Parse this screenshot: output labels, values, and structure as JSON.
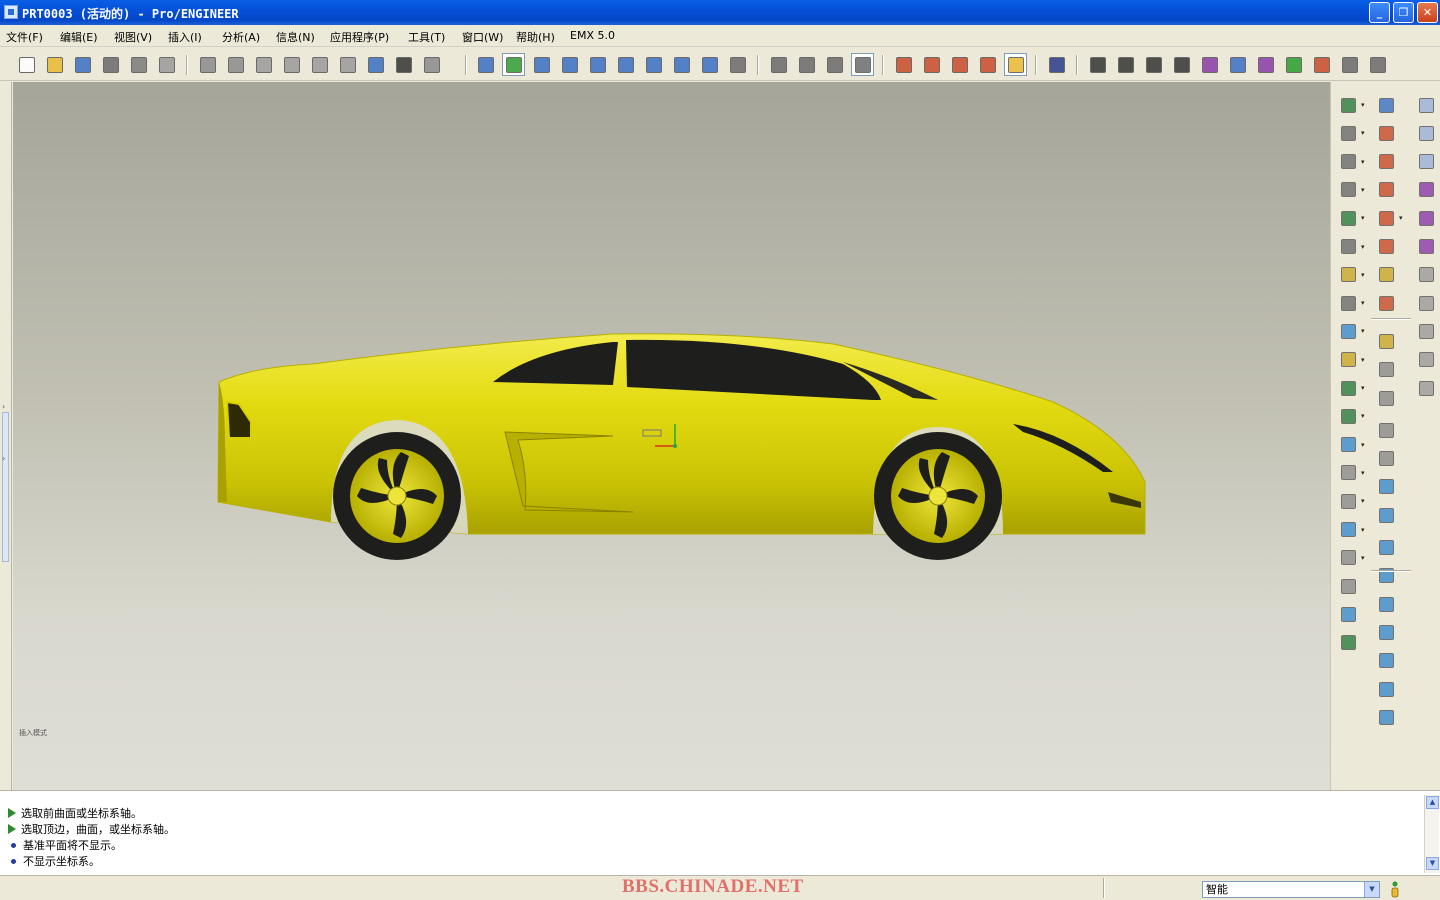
{
  "window": {
    "title": "PRT0003 (活动的) - Pro/ENGINEER",
    "minimize_label": "_",
    "restore_label": "❐",
    "close_label": "✕"
  },
  "menu": [
    {
      "label": "文件(F)"
    },
    {
      "label": "编辑(E)"
    },
    {
      "label": "视图(V)"
    },
    {
      "label": "插入(I)"
    },
    {
      "label": "分析(A)"
    },
    {
      "label": "信息(N)"
    },
    {
      "label": "应用程序(P)"
    },
    {
      "label": "工具(T)"
    },
    {
      "label": "窗口(W)"
    },
    {
      "label": "帮助(H)"
    },
    {
      "label": "EMX 5.0"
    }
  ],
  "toolbar": {
    "buttons": [
      {
        "icon": "new-file-icon",
        "color": "#FFFFFF"
      },
      {
        "icon": "open-folder-icon",
        "color": "#E8B830"
      },
      {
        "icon": "save-icon",
        "color": "#3A6FC4"
      },
      {
        "icon": "print-icon",
        "color": "#6A6A6A"
      },
      {
        "icon": "send-mail-icon",
        "color": "#7A7A7A"
      },
      {
        "icon": "print-preview-icon",
        "color": "#9A9A9A"
      },
      {
        "icon": "undo-icon",
        "color": "#8A8A8A"
      },
      {
        "icon": "redo-icon",
        "color": "#8A8A8A"
      },
      {
        "icon": "cut-icon",
        "color": "#9A9A9A"
      },
      {
        "icon": "copy-icon",
        "color": "#9A9A9A"
      },
      {
        "icon": "paste-icon",
        "color": "#9A9A9A"
      },
      {
        "icon": "paste-special-icon",
        "color": "#9A9A9A"
      },
      {
        "icon": "regenerate-icon",
        "color": "#3A6FC4"
      },
      {
        "icon": "find-icon",
        "color": "#333333"
      },
      {
        "icon": "selection-box-icon",
        "color": "#8A8A8A"
      },
      {
        "icon": "repaint-icon",
        "color": "#3A6FC4"
      },
      {
        "icon": "spin-center-icon",
        "color": "#2C9C2C"
      },
      {
        "icon": "orient-mode-icon",
        "color": "#3A6FC4"
      },
      {
        "icon": "zoom-in-icon",
        "color": "#3A6FC4"
      },
      {
        "icon": "zoom-out-icon",
        "color": "#3A6FC4"
      },
      {
        "icon": "refit-icon",
        "color": "#3A6FC4"
      },
      {
        "icon": "reorient-icon",
        "color": "#3A6FC4"
      },
      {
        "icon": "saved-views-icon",
        "color": "#3A6FC4"
      },
      {
        "icon": "layers-icon",
        "color": "#3A6FC4"
      },
      {
        "icon": "view-manager-icon",
        "color": "#6A6A6A"
      },
      {
        "icon": "wireframe-icon",
        "color": "#6A6A6A"
      },
      {
        "icon": "hidden-line-icon",
        "color": "#6A6A6A"
      },
      {
        "icon": "no-hidden-icon",
        "color": "#6A6A6A"
      },
      {
        "icon": "shading-icon",
        "color": "#6A6A6A"
      },
      {
        "icon": "datum-plane-toggle-icon",
        "color": "#C84A2A"
      },
      {
        "icon": "datum-axis-toggle-icon",
        "color": "#C84A2A"
      },
      {
        "icon": "datum-point-toggle-icon",
        "color": "#C84A2A"
      },
      {
        "icon": "coordinate-system-toggle-icon",
        "color": "#C84A2A"
      },
      {
        "icon": "annotation-toggle-icon",
        "color": "#E8B830"
      },
      {
        "icon": "context-help-icon",
        "color": "#2A3A8A"
      },
      {
        "icon": "measure-distance-icon",
        "color": "#333333"
      },
      {
        "icon": "measure-angle-icon",
        "color": "#333333"
      },
      {
        "icon": "measure-area-icon",
        "color": "#333333"
      },
      {
        "icon": "mass-properties-icon",
        "color": "#333333"
      },
      {
        "icon": "curvature-analysis-icon",
        "color": "#8A3AA8"
      },
      {
        "icon": "section-analysis-icon",
        "color": "#3A6FC4"
      },
      {
        "icon": "deviation-analysis-icon",
        "color": "#8A3AA8"
      },
      {
        "icon": "draft-analysis-icon",
        "color": "#2C9C2C"
      },
      {
        "icon": "reflection-analysis-icon",
        "color": "#C84A2A"
      },
      {
        "icon": "saved-analysis-icon",
        "color": "#6A6A6A"
      },
      {
        "icon": "hide-analysis-icon",
        "color": "#6A6A6A"
      }
    ]
  },
  "right_tools": {
    "col1": [
      {
        "icon": "hole-tool-icon",
        "color": "#2C7C3C"
      },
      {
        "icon": "shell-tool-icon",
        "color": "#6A6A6A"
      },
      {
        "icon": "rib-tool-icon",
        "color": "#6A6A6A"
      },
      {
        "icon": "draft-tool-icon",
        "color": "#6A6A6A"
      },
      {
        "icon": "round-tool-icon",
        "color": "#2C7C3C"
      },
      {
        "icon": "chamfer-tool-icon",
        "color": "#6A6A6A"
      },
      {
        "icon": "cosmetic-thread-icon",
        "color": "#C8A82A"
      },
      {
        "icon": "extrude-tool-icon",
        "color": "#6A6A6A"
      },
      {
        "icon": "revolve-tool-icon",
        "color": "#3A8ACA"
      },
      {
        "icon": "variable-section-sweep-icon",
        "color": "#C8A82A"
      },
      {
        "icon": "boundary-blend-icon",
        "color": "#2C7C3C"
      },
      {
        "icon": "style-tool-icon",
        "color": "#2C7C3C"
      },
      {
        "icon": "merge-tool-icon",
        "color": "#3A8ACA"
      },
      {
        "icon": "trim-tool-icon",
        "color": "#8A8A8A"
      },
      {
        "icon": "pattern-tool-icon",
        "color": "#8A8A8A"
      },
      {
        "icon": "mirror-tool-icon",
        "color": "#3A8ACA"
      },
      {
        "icon": "rebuild-tool-icon",
        "color": "#8A8A8A"
      },
      {
        "icon": "freeform-tool-icon",
        "color": "#8A8A8A"
      },
      {
        "icon": "warp-tool-icon",
        "color": "#3A8ACA"
      },
      {
        "icon": "emx-icon",
        "color": "#2C7C3C"
      }
    ],
    "col2": [
      {
        "icon": "sketch-tool-icon",
        "color": "#3A6FC4"
      },
      {
        "icon": "datum-plane-tool-icon",
        "color": "#C84A2A"
      },
      {
        "icon": "datum-axis-tool-icon",
        "color": "#C84A2A"
      },
      {
        "icon": "datum-curve-tool-icon",
        "color": "#C84A2A"
      },
      {
        "icon": "datum-point-tool-icon",
        "color": "#C84A2A"
      },
      {
        "icon": "coordinate-system-tool-icon",
        "color": "#C84A2A"
      },
      {
        "icon": "analysis-feature-icon",
        "color": "#C8A82A"
      },
      {
        "icon": "chain-tool-icon",
        "color": "#C84A2A"
      },
      {
        "icon": "placement-tool-icon",
        "color": "#C8A82A"
      },
      {
        "icon": "copy-paste-tool-icon",
        "color": "#8A8A8A"
      },
      {
        "icon": "shape-tool-icon",
        "color": "#8A8A8A"
      },
      {
        "icon": "offset-tool-icon",
        "color": "#8A8A8A"
      },
      {
        "icon": "thicken-tool-icon",
        "color": "#8A8A8A"
      },
      {
        "icon": "solidify-tool-icon",
        "color": "#3A8ACA"
      },
      {
        "icon": "extend-tool-icon",
        "color": "#3A8ACA"
      },
      {
        "icon": "intersect-tool-icon",
        "color": "#3A8ACA"
      },
      {
        "icon": "project-tool-icon",
        "color": "#3A8ACA"
      },
      {
        "icon": "wrap-tool-icon",
        "color": "#3A8ACA"
      },
      {
        "icon": "fill-tool-icon",
        "color": "#3A8ACA"
      },
      {
        "icon": "blend-surface-icon",
        "color": "#3A8ACA"
      },
      {
        "icon": "boundary-surface-icon",
        "color": "#3A8ACA"
      },
      {
        "icon": "quilt-surface-icon",
        "color": "#3A8ACA"
      }
    ],
    "col3": [
      {
        "icon": "sweep-blend-icon",
        "color": "#9AB0D8"
      },
      {
        "icon": "helical-sweep-icon",
        "color": "#9AB0D8"
      },
      {
        "icon": "swept-blend-icon",
        "color": "#9AB0D8"
      },
      {
        "icon": "datum-table-icon",
        "color": "#8A3AA8"
      },
      {
        "icon": "graph-tool-icon",
        "color": "#8A3AA8"
      },
      {
        "icon": "wave-surface-icon",
        "color": "#8A3AA8"
      },
      {
        "icon": "cross-section-tool-icon",
        "color": "#9A9A9A"
      },
      {
        "icon": "offset-plane-icon",
        "color": "#9A9A9A"
      },
      {
        "icon": "rotate-plane-icon",
        "color": "#9A9A9A"
      },
      {
        "icon": "flip-tool-icon",
        "color": "#9A9A9A"
      },
      {
        "icon": "surface-patch-icon",
        "color": "#9A9A9A"
      }
    ]
  },
  "viewport": {
    "background_top": "#A5A59A",
    "background_bottom": "#DFDED5",
    "model_color": "#E3DB10",
    "model_tree_label": "插入模式"
  },
  "messages": [
    {
      "type": "prompt",
      "text": "选取前曲面或坐标系轴。"
    },
    {
      "type": "prompt",
      "text": "选取顶边，曲面，或坐标系轴。"
    },
    {
      "type": "info",
      "text": "基准平面将不显示。"
    },
    {
      "type": "info",
      "text": "不显示坐标系。"
    }
  ],
  "status": {
    "watermark": "BBS.CHINADE.NET",
    "filter_value": "智能"
  }
}
